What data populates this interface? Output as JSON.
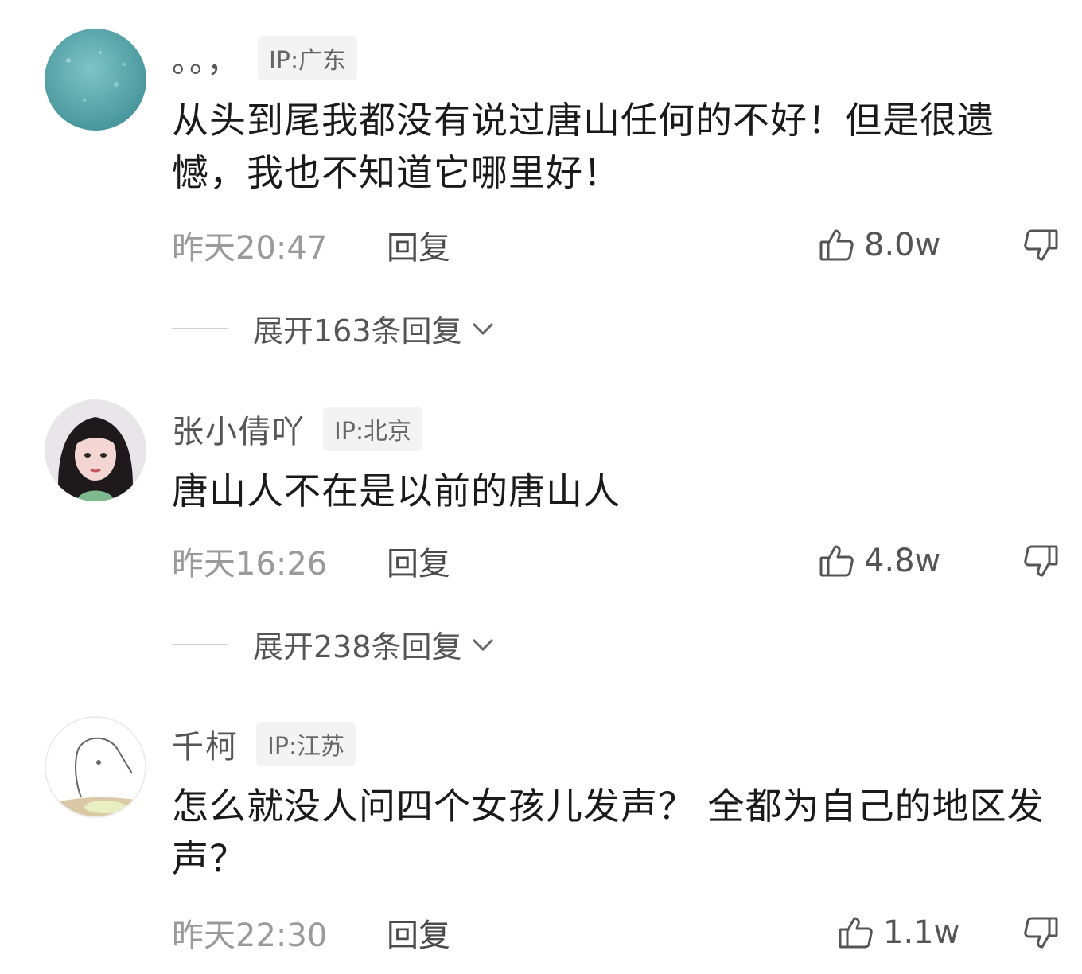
{
  "comments": [
    {
      "username": "。。，",
      "ip": "IP:广东",
      "text": "从头到尾我都没有说过唐山任何的不好！但是很遗憾，我也不知道它哪里好！",
      "time": "昨天20:47",
      "reply_label": "回复",
      "likes": "8.0w",
      "expand": "展开163条回复"
    },
    {
      "username": "张小倩吖",
      "ip": "IP:北京",
      "text": "唐山人不在是以前的唐山人",
      "time": "昨天16:26",
      "reply_label": "回复",
      "likes": "4.8w",
      "expand": "展开238条回复"
    },
    {
      "username": "千柯",
      "ip": "IP:江苏",
      "text": "怎么就没人问四个女孩儿发声？ 全都为自己的地区发声？",
      "time": "昨天22:30",
      "reply_label": "回复",
      "likes": "1.1w"
    }
  ],
  "icons": {
    "like": "thumbs-up-icon",
    "dislike": "thumbs-down-icon",
    "chevron": "chevron-down-icon"
  },
  "colors": {
    "text": "#1a1a1a",
    "meta": "#9a9a9a",
    "badge_bg": "#f3f3f3"
  }
}
